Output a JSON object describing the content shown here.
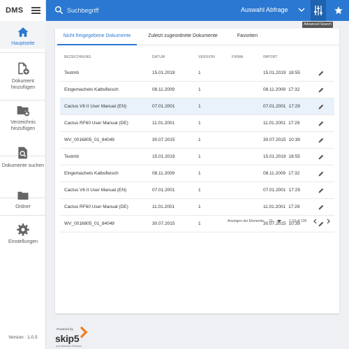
{
  "app": {
    "brand": "DMS"
  },
  "header": {
    "search_placeholder": "Suchbegriff",
    "query_select": "Auswahl Abfrage",
    "tooltip": "Advanced Search"
  },
  "sidebar": {
    "items": [
      {
        "label": "Hauptseite",
        "icon": "home-icon"
      },
      {
        "label": "Dokument hinzufügen",
        "icon": "add-document-icon"
      },
      {
        "label": "Verzeichnis hinzufügen",
        "icon": "add-folder-icon"
      },
      {
        "label": "Dokumente suchen",
        "icon": "search-document-icon"
      },
      {
        "label": "Ordner",
        "icon": "folder-icon"
      },
      {
        "label": "Einstellungen",
        "icon": "gear-icon"
      }
    ],
    "version": "Version : 1.0.5"
  },
  "main": {
    "tabs": [
      {
        "label": "Nicht freigegebene Dokumente"
      },
      {
        "label": "Zuletzt zugeordnete Dokumente"
      },
      {
        "label": "Favoriten"
      }
    ],
    "columns": {
      "name": "BEZEICHNUNG",
      "date": "DATUM",
      "version": "VERSION",
      "company": "FIRMA",
      "import": "IMPORT"
    },
    "rows": [
      {
        "name": "Testmb",
        "date": "15.01.2019",
        "version": "1",
        "company": "",
        "import_date": "15.01.2019",
        "import_time": "18:55"
      },
      {
        "name": "Eingemachets Kalbsfleisch",
        "date": "08.11.2009",
        "version": "1",
        "company": "",
        "import_date": "08.11.2009",
        "import_time": "17:32"
      },
      {
        "name": "Cactus V6 II User Manual (EN)",
        "date": "07.01.2001",
        "version": "1",
        "company": "",
        "import_date": "07.01.2001",
        "import_time": "17:29"
      },
      {
        "name": "Cactus RF60 User Manual (DE)",
        "date": "11.01.2001",
        "version": "1",
        "company": "",
        "import_date": "11.01.2001",
        "import_time": "17:29"
      },
      {
        "name": "WV_0016805_01_84049",
        "date": "30.07.2015",
        "version": "1",
        "company": "",
        "import_date": "30.07.2015",
        "import_time": "10:39"
      },
      {
        "name": "Testmb",
        "date": "15.01.2019",
        "version": "1",
        "company": "",
        "import_date": "15.01.2019",
        "import_time": "18:55"
      },
      {
        "name": "Eingemachets Kalbsfleisch",
        "date": "08.11.2009",
        "version": "1",
        "company": "",
        "import_date": "08.11.2009",
        "import_time": "17:32"
      },
      {
        "name": "Cactus V6 II User Manual (EN)",
        "date": "07.01.2001",
        "version": "1",
        "company": "",
        "import_date": "07.01.2001",
        "import_time": "17:29"
      },
      {
        "name": "Cactus RF60 User Manual (DE)",
        "date": "11.01.2001",
        "version": "1",
        "company": "",
        "import_date": "11.01.2001",
        "import_time": "17:29"
      },
      {
        "name": "WV_0016805_01_84049",
        "date": "30.07.2015",
        "version": "1",
        "company": "",
        "import_date": "30.07.2015",
        "import_time": "10:39"
      }
    ],
    "pager": {
      "label": "Anzeigen der Elemente:",
      "page_size": "10",
      "range": "1-10 of 130"
    }
  },
  "footer": {
    "powered_by": "Powered by",
    "logo_text": "skip5",
    "logo_sub": "your Business Software"
  },
  "colors": {
    "accent": "#2a78d1",
    "accent_dark": "#1f62ad",
    "selected_row": "#e9f1fb",
    "logo_orange": "#f07c1a"
  }
}
